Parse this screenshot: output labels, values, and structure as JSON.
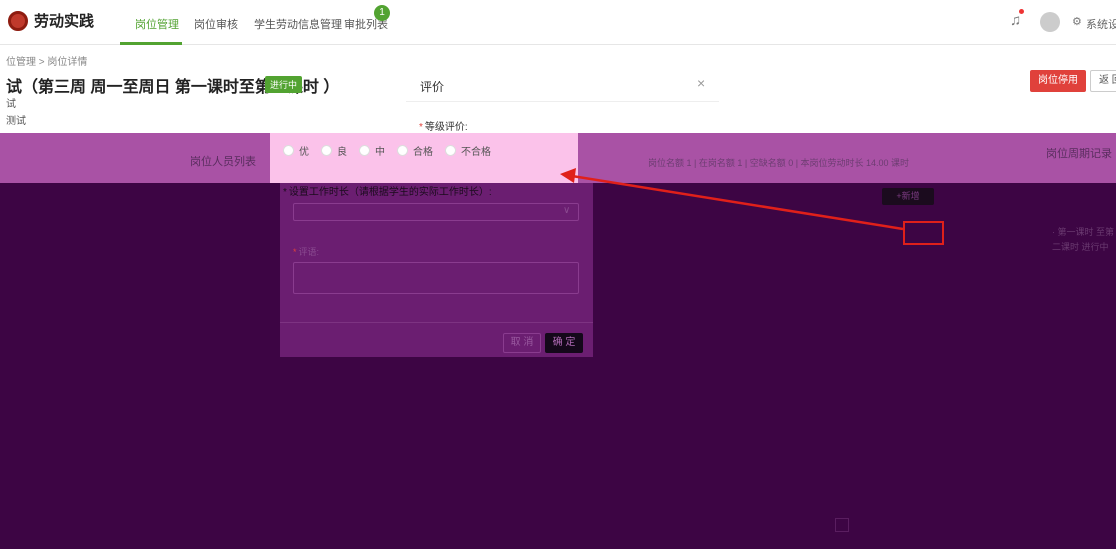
{
  "nav": {
    "app_name": "劳动实践",
    "tabs": [
      {
        "label": "岗位管理"
      },
      {
        "label": "岗位审核"
      },
      {
        "label": "学生劳动信息管理"
      },
      {
        "label": "审批列表"
      }
    ],
    "badge_count": "1",
    "settings_label": "系统设置"
  },
  "header": {
    "breadcrumb": "位管理 > 岗位详情",
    "title": "试（第三周 周一至周日 第一课时至第二课时 ）",
    "status": "进行中",
    "sub1": "试",
    "sub2": "测试",
    "stop_button": "岗位停用",
    "back_button": "返 回"
  },
  "background": {
    "card_title": "岗位人员列表",
    "stats": "岗位名额 1  |  在岗名额 1  |  空缺名额 0  |  本岗位劳动时长 14.00 课时",
    "period_title": "岗位周期记录",
    "add_button": "+新增",
    "period_line1": "· 第一课时 至第",
    "period_line2": "二课时 进行中"
  },
  "modal": {
    "title": "评价",
    "close": "×",
    "grade_label": "等级评价:",
    "grades": [
      {
        "label": "优"
      },
      {
        "label": "良"
      },
      {
        "label": "中"
      },
      {
        "label": "合格"
      },
      {
        "label": "不合格"
      }
    ],
    "worktime_label": "设置工作时长（请根据学生的实际工作时长）:",
    "comment_label": "评语:",
    "cancel": "取 消",
    "confirm": "确 定"
  },
  "colors": {
    "accent": "#52a331",
    "danger": "#e0413b",
    "overlay": "#3d0544",
    "highlight": "#fbc2ea"
  }
}
